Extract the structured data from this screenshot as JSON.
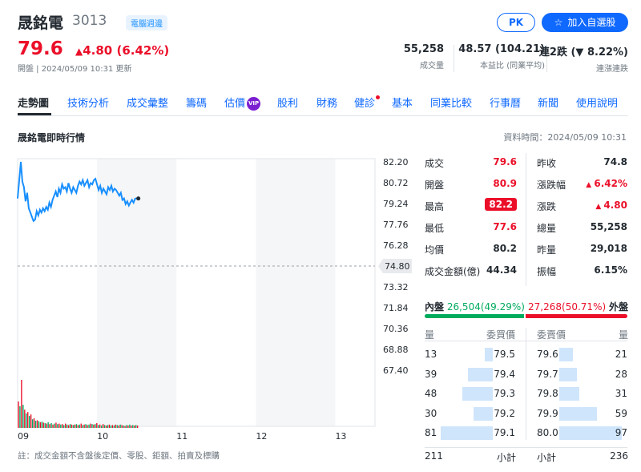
{
  "header": {
    "name": "晟銘電",
    "code": "3013",
    "tag": "電腦週邊",
    "price": "79.6",
    "change": "4.80 (6.42%)",
    "status": "開盤 | 2024/05/09 10:31 更新",
    "pk_button": "PK",
    "add_button": "加入自選股"
  },
  "kpis": [
    {
      "value": "55,258",
      "label": "成交量"
    },
    {
      "value": "48.57 (104.21)",
      "label": "本益比 (同業平均)"
    },
    {
      "value": "連2跌 (▼ 8.22%)",
      "label": "連漲連跌"
    }
  ],
  "tabs": [
    "走勢圖",
    "技術分析",
    "成交彙整",
    "籌碼",
    "估價",
    "股利",
    "財務",
    "健診",
    "基本",
    "同業比較",
    "行事曆",
    "新聞",
    "使用說明"
  ],
  "vip_label": "VIP",
  "section": {
    "title": "晟銘電即時行情",
    "data_time": "資料時間：2024/05/09 10:31"
  },
  "chart_data": {
    "type": "line",
    "x_ticks": [
      "09",
      "10",
      "11",
      "12",
      "13"
    ],
    "y_ticks": [
      "82.20",
      "80.72",
      "79.24",
      "77.76",
      "76.28",
      "74.80",
      "73.32",
      "71.84",
      "70.36",
      "68.88",
      "67.40"
    ],
    "reference": "74.80",
    "ylim": [
      67.4,
      82.2
    ],
    "series": [
      {
        "x": [
          9.0,
          9.02,
          9.04,
          9.06,
          9.08,
          9.1,
          9.12,
          9.14,
          9.16,
          9.18,
          9.2,
          9.22,
          9.24,
          9.26,
          9.28,
          9.3,
          9.32,
          9.34,
          9.36,
          9.38,
          9.4,
          9.42,
          9.44,
          9.46,
          9.48,
          9.5,
          9.52,
          9.54,
          9.56,
          9.58,
          9.6,
          9.62,
          9.64,
          9.66,
          9.68,
          9.7,
          9.72,
          9.74,
          9.76,
          9.78,
          9.8,
          9.82,
          9.84,
          9.86,
          9.88,
          9.9,
          9.92,
          9.94,
          9.96,
          9.98,
          10.0,
          10.02,
          10.04,
          10.06,
          10.08,
          10.1,
          10.12,
          10.14,
          10.16,
          10.18,
          10.2,
          10.22,
          10.24,
          10.26,
          10.28,
          10.3,
          10.32,
          10.34,
          10.36,
          10.38,
          10.4,
          10.42,
          10.44,
          10.46,
          10.48,
          10.5,
          10.52
        ],
        "y": [
          79.6,
          80.9,
          82.2,
          80.8,
          80.4,
          79.4,
          80.0,
          78.9,
          78.6,
          78.3,
          78.0,
          78.1,
          78.7,
          78.4,
          78.8,
          78.6,
          78.9,
          78.7,
          79.0,
          78.8,
          79.3,
          79.0,
          79.5,
          79.8,
          80.1,
          79.7,
          80.3,
          80.0,
          80.6,
          80.3,
          80.4,
          80.1,
          80.7,
          80.3,
          80.0,
          80.4,
          80.2,
          80.0,
          80.5,
          80.8,
          80.6,
          80.9,
          80.5,
          80.7,
          80.9,
          80.4,
          80.7,
          80.6,
          80.9,
          81.0,
          80.6,
          80.2,
          80.5,
          80.0,
          80.3,
          80.1,
          79.9,
          80.4,
          80.2,
          80.5,
          80.1,
          80.3,
          80.2,
          80.0,
          79.8,
          80.0,
          79.5,
          79.6,
          79.2,
          79.4,
          79.1,
          79.3,
          79.5,
          79.3,
          79.6,
          79.6,
          79.6
        ]
      }
    ],
    "volume_max": 100,
    "volume": [
      55,
      45,
      100,
      48,
      38,
      30,
      33,
      25,
      28,
      18,
      20,
      15,
      16,
      14,
      12,
      13,
      11,
      10,
      9,
      12,
      8,
      10,
      7,
      9,
      11,
      8,
      9,
      7,
      8,
      6,
      9,
      7,
      6,
      8,
      7,
      6,
      7,
      8,
      6,
      7,
      9,
      6,
      7,
      8,
      6,
      7,
      9,
      8,
      7,
      8,
      10,
      6,
      7,
      5,
      8,
      6,
      5,
      6,
      7,
      5,
      6,
      5,
      7,
      6,
      5,
      7,
      6,
      5,
      4,
      6,
      5,
      7,
      5,
      6,
      5,
      6,
      5
    ],
    "volume_colors": [
      "#eb0f29",
      "#00ab5e"
    ]
  },
  "stats": {
    "left": [
      {
        "label": "成交",
        "value": "79.6"
      },
      {
        "label": "開盤",
        "value": "80.9"
      },
      {
        "label": "最高",
        "value": "82.2"
      },
      {
        "label": "最低",
        "value": "77.6"
      },
      {
        "label": "均價",
        "value": "80.2"
      },
      {
        "label": "成交金額(億)",
        "value": "44.34"
      }
    ],
    "right": [
      {
        "label": "昨收",
        "value": "74.8"
      },
      {
        "label": "漲跌幅",
        "value": "6.42%"
      },
      {
        "label": "漲跌",
        "value": "4.80"
      },
      {
        "label": "總量",
        "value": "55,258"
      },
      {
        "label": "昨量",
        "value": "29,018"
      },
      {
        "label": "振幅",
        "value": "6.15%"
      }
    ]
  },
  "order_book": {
    "inner_label": "內盤",
    "inner_value": "26,504",
    "inner_pct": "(49.29%)",
    "outer_value": "27,268",
    "outer_pct": "(50.71%)",
    "outer_label": "外盤",
    "inner_ratio": 49.29,
    "bid_headers": [
      "量",
      "委買價"
    ],
    "ask_headers": [
      "委賣價",
      "量"
    ],
    "bids": [
      {
        "qty": "13",
        "price": "79.5",
        "level": 13
      },
      {
        "qty": "39",
        "price": "79.4",
        "level": 39
      },
      {
        "qty": "48",
        "price": "79.3",
        "level": 48
      },
      {
        "qty": "30",
        "price": "79.2",
        "level": 30
      },
      {
        "qty": "81",
        "price": "79.1",
        "level": 81
      }
    ],
    "asks": [
      {
        "price": "79.6",
        "qty": "21",
        "level": 21
      },
      {
        "price": "79.7",
        "qty": "28",
        "level": 28
      },
      {
        "price": "79.8",
        "qty": "31",
        "level": 31
      },
      {
        "price": "79.9",
        "qty": "59",
        "level": 59
      },
      {
        "price": "80.0",
        "qty": "97",
        "level": 97
      }
    ],
    "bid_total": "211",
    "bid_total_label": "小計",
    "ask_total_label": "小計",
    "ask_total": "236"
  },
  "note": "註：成交金額不含盤後定價、零股、鉅額、拍賣及標購"
}
